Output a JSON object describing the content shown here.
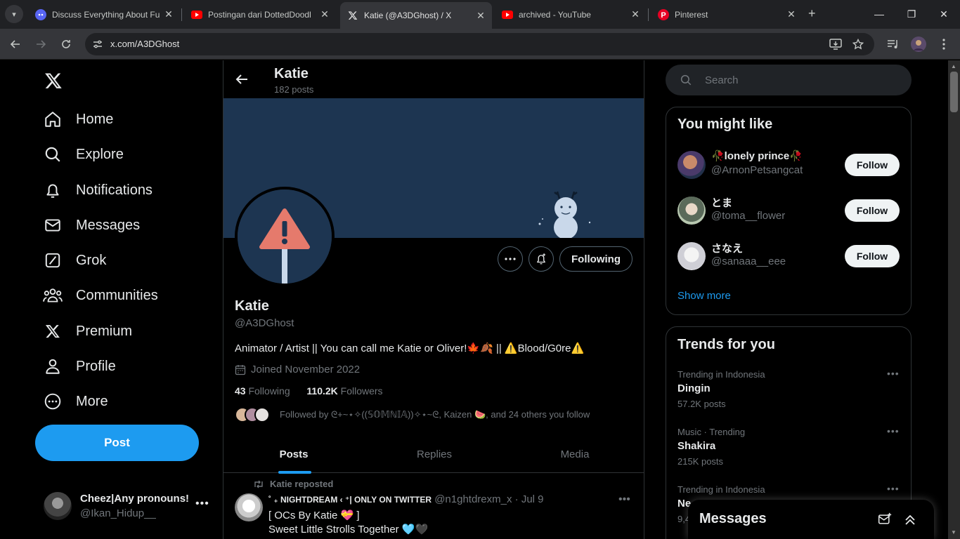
{
  "browser": {
    "tabs": [
      {
        "title": "Discuss Everything About Fu",
        "icon": "discord-icon",
        "active": false
      },
      {
        "title": "Postingan dari DottedDoodl",
        "icon": "youtube-icon",
        "active": false
      },
      {
        "title": "Katie (@A3DGhost) / X",
        "icon": "x-icon",
        "active": true
      },
      {
        "title": "archived - YouTube",
        "icon": "youtube-icon",
        "active": false
      },
      {
        "title": "Pinterest",
        "icon": "pinterest-icon",
        "active": false
      }
    ],
    "url": "x.com/A3DGhost"
  },
  "nav": {
    "items": [
      {
        "label": "Home",
        "icon": "home-icon"
      },
      {
        "label": "Explore",
        "icon": "search-icon"
      },
      {
        "label": "Notifications",
        "icon": "bell-icon"
      },
      {
        "label": "Messages",
        "icon": "mail-icon"
      },
      {
        "label": "Grok",
        "icon": "grok-icon"
      },
      {
        "label": "Communities",
        "icon": "communities-icon"
      },
      {
        "label": "Premium",
        "icon": "x-icon"
      },
      {
        "label": "Profile",
        "icon": "person-icon"
      },
      {
        "label": "More",
        "icon": "more-circle-icon"
      }
    ],
    "post_label": "Post",
    "account": {
      "name": "Cheez|Any pronouns!",
      "handle": "@Ikan_Hidup__"
    }
  },
  "profile": {
    "header_name": "Katie",
    "post_count": "182 posts",
    "name": "Katie",
    "handle": "@A3DGhost",
    "bio": "Animator / Artist || You can call me Katie or Oliver!🍁🍂 || ⚠️Blood/G0re⚠️",
    "joined": "Joined November 2022",
    "following_count": "43",
    "following_label": "Following",
    "followers_count": "110.2K",
    "followers_label": "Followers",
    "followed_by": "Followed by ᘓ+~⋆✧((𝕊𝕆𝕄ℕ𝕀𝔸))✧⋆~ᘓ, Kaizen 🍉, and 24 others you follow",
    "following_button": "Following",
    "tabs": [
      "Posts",
      "Replies",
      "Media"
    ]
  },
  "tweet": {
    "repost_label": "Katie reposted",
    "author": "˚ ₊ NIGHTDREAM ‹ ⁺| ONLY ON TWITTER",
    "handle": "@n1ghtdrexm_x",
    "date": "· Jul 9",
    "line1": "[ OCs By Katie 💝 ]",
    "line2": "Sweet Little Strolls Together 🩵🖤"
  },
  "search": {
    "placeholder": "Search"
  },
  "you_might_like": {
    "title": "You might like",
    "users": [
      {
        "name": "🥀lonely prince🥀",
        "handle": "@ArnonPetsangcat",
        "button": "Follow"
      },
      {
        "name": "とま",
        "handle": "@toma__flower",
        "button": "Follow"
      },
      {
        "name": "さなえ",
        "handle": "@sanaaa__eee",
        "button": "Follow"
      }
    ],
    "show_more": "Show more"
  },
  "trends": {
    "title": "Trends for you",
    "items": [
      {
        "meta": "Trending in Indonesia",
        "title": "Dingin",
        "count": "57.2K posts"
      },
      {
        "meta": "Music · Trending",
        "title": "Shakira",
        "count": "215K posts"
      },
      {
        "meta": "Trending in Indonesia",
        "title": "Ne",
        "count": "9,4"
      }
    ]
  },
  "messages_drawer": {
    "title": "Messages"
  },
  "colors": {
    "accent": "#1d9bf0",
    "banner": "#1d3551",
    "background": "#000000"
  }
}
